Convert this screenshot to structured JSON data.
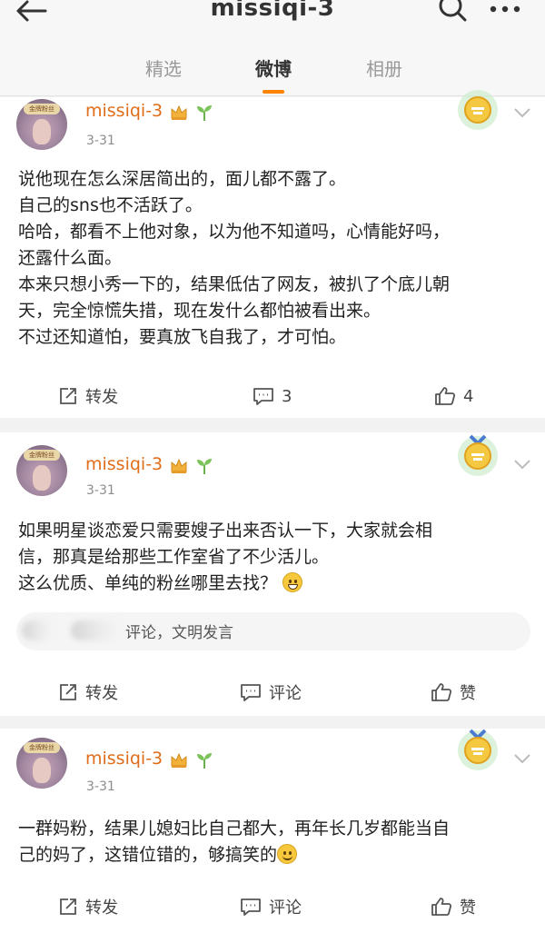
{
  "header": {
    "title": "missiqi-3"
  },
  "tabs": [
    {
      "label": "精选"
    },
    {
      "label": "微博"
    },
    {
      "label": "相册"
    }
  ],
  "posts": [
    {
      "username": "missiqi-3",
      "date": "3-31",
      "avatar_badge": "金牌粉丝",
      "lines": [
        "说他现在怎么深居简出的，面儿都不露了。",
        "自己的sns也不活跃了。",
        "哈哈，都看不上他对象，以为他不知道吗，心情能好吗，",
        "还露什么面。",
        "本来只想小秀一下的，结果低估了网友，被扒了个底儿朝",
        "天，完全惊慌失措，现在发什么都怕被看出来。",
        "不过还知道怕，要真放飞自我了，才可怕。"
      ],
      "actions": {
        "repost": "转发",
        "comment": "3",
        "like": "4"
      }
    },
    {
      "username": "missiqi-3",
      "date": "3-31",
      "avatar_badge": "金牌粉丝",
      "lines": [
        "如果明星谈恋爱只需要嫂子出来否认一下，大家就会相",
        "信，那真是给那些工作室省了不少活儿。",
        "这么优质、单纯的粉丝哪里去找？"
      ],
      "comment_hint": "评论，文明发言",
      "actions": {
        "repost": "转发",
        "comment": "评论",
        "like": "赞"
      }
    },
    {
      "username": "missiqi-3",
      "date": "3-31",
      "avatar_badge": "金牌粉丝",
      "lines": [
        "一群妈粉，结果儿媳妇比自己都大，再年长几岁都能当自",
        "己的妈了，这错位错的，够搞笑的"
      ],
      "actions": {
        "repost": "转发",
        "comment": "评论",
        "like": "赞"
      }
    }
  ],
  "colors": {
    "accent": "#ff8200",
    "username": "#e06d1a",
    "background": "#f2f2f2"
  }
}
